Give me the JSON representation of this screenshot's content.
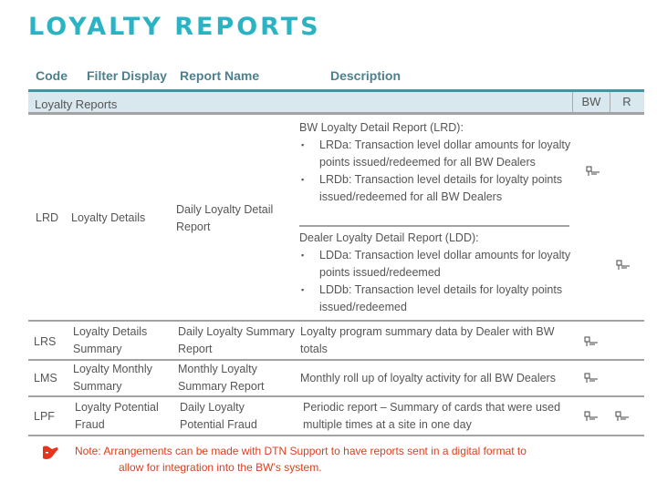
{
  "title": "LOYALTY REPORTS",
  "columns": {
    "code": "Code",
    "filter_display": "Filter Display",
    "report_name": "Report Name",
    "description": "Description"
  },
  "section": {
    "label": "Loyalty Reports",
    "bw": "BW",
    "r": "R"
  },
  "rows": [
    {
      "code": "LRD",
      "filter": "Loyalty Details",
      "name": "Daily Loyalty Detail Report",
      "desc_blocks": [
        {
          "heading": "BW Loyalty Detail Report (LRD):",
          "bullets": [
            "LRDa: Transaction level dollar amounts for loyalty points issued/redeemed for all BW Dealers",
            "LRDb: Transaction level details for loyalty points issued/redeemed for all BW Dealers"
          ],
          "bw": true,
          "r": false
        },
        {
          "heading": "Dealer Loyalty Detail Report (LDD):",
          "bullets": [
            "LDDa: Transaction level dollar amounts for loyalty points issued/redeemed",
            "LDDb: Transaction level details for loyalty points issued/redeemed"
          ],
          "bw": false,
          "r": true
        }
      ]
    },
    {
      "code": "LRS",
      "filter": "Loyalty Details Summary",
      "name": "Daily Loyalty Summary Report",
      "desc": "Loyalty program summary data by Dealer with BW totals",
      "bw": true,
      "r": false
    },
    {
      "code": "LMS",
      "filter": "Loyalty Monthly Summary",
      "name": "Monthly Loyalty Summary Report",
      "desc": "Monthly roll up of loyalty activity for all BW Dealers",
      "bw": true,
      "r": false
    },
    {
      "code": "LPF",
      "filter": "Loyalty Potential Fraud",
      "name": "Daily Loyalty Potential Fraud",
      "desc": "Periodic report – Summary of cards that were used multiple times at a site in one day",
      "bw": true,
      "r": true
    }
  ],
  "icons": {
    "check": "pointing-hand-check-icon",
    "note": "pointing-hand-icon"
  },
  "note": {
    "line1": "Note:  Arrangements can be made with DTN Support to have reports sent in a digital format to",
    "line2": "allow for integration into the BW’s system."
  },
  "colors": {
    "title": "#2bb3c4",
    "header": "#4d7f8c",
    "band": "#d9e8ee",
    "note": "#d9411e"
  }
}
